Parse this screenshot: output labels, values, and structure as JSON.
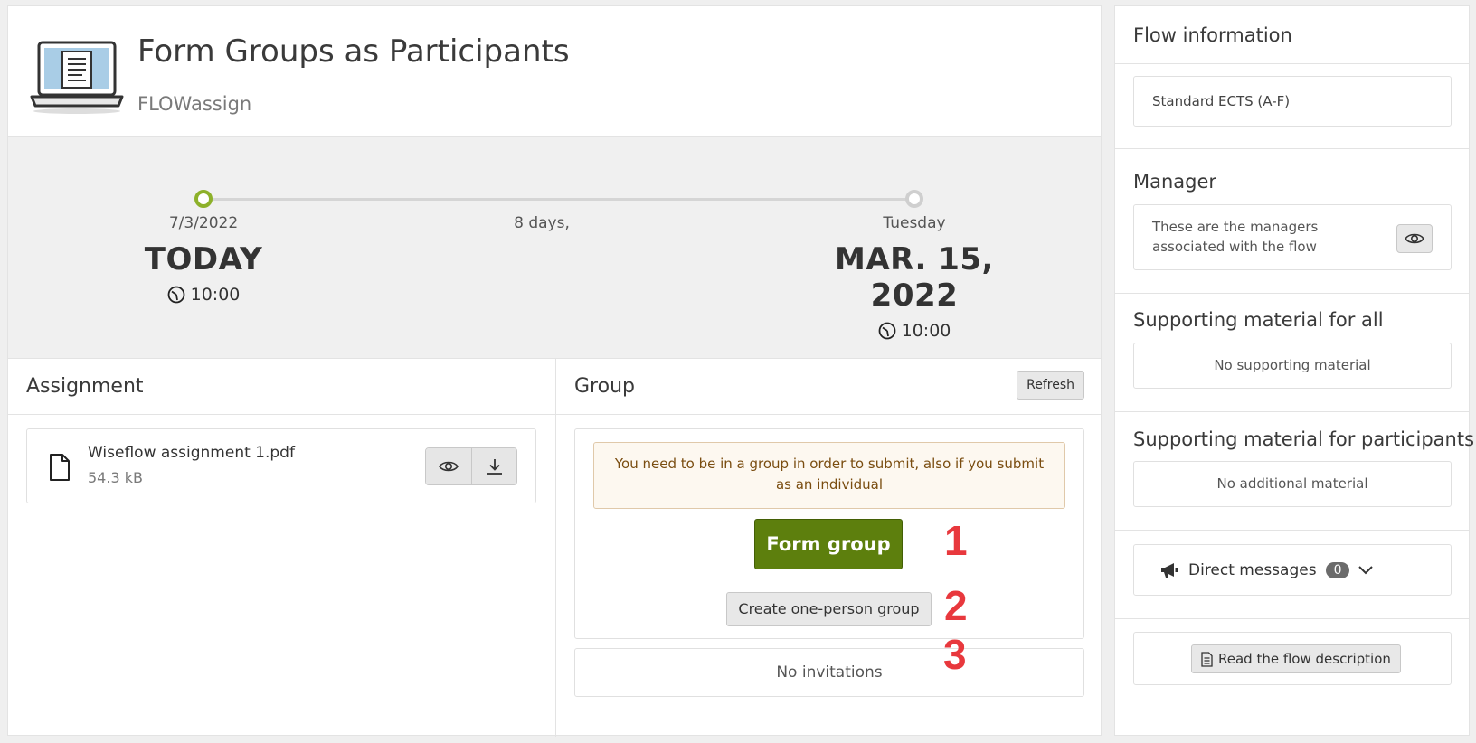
{
  "header": {
    "title": "Form Groups as Participants",
    "subtitle": "FLOWassign"
  },
  "timeline": {
    "start": {
      "date": "7/3/2022",
      "label": "TODAY",
      "time": "10:00"
    },
    "middle": {
      "label": "8 days,"
    },
    "end": {
      "weekday": "Tuesday",
      "label": "MAR. 15, 2022",
      "time": "10:00"
    },
    "colors": {
      "start_dot": "#8db12a",
      "end_dot": "#cfcfcf"
    }
  },
  "assignment": {
    "title": "Assignment",
    "file": {
      "name": "Wiseflow assignment 1.pdf",
      "size": "54.3 kB"
    }
  },
  "group": {
    "title": "Group",
    "refresh_label": "Refresh",
    "alert": "You need to be in a group in order to submit, also if you submit as an individual",
    "form_group_label": "Form group",
    "one_person_label": "Create one-person group",
    "invitations": "No invitations",
    "annotations": [
      "1",
      "2",
      "3"
    ]
  },
  "sidebar": {
    "flow_info": {
      "title": "Flow information",
      "grading": "Standard ECTS (A-F)"
    },
    "manager": {
      "title": "Manager",
      "text": "These are the managers associated with the flow"
    },
    "support_all": {
      "title": "Supporting material for all",
      "text": "No supporting material"
    },
    "support_participants": {
      "title": "Supporting material for participants",
      "text": "No additional material"
    },
    "direct_messages": {
      "label": "Direct messages",
      "count": "0"
    },
    "description_button": "Read the flow description"
  },
  "colors": {
    "primary": "#5d7f0d",
    "annotation": "#e8383d",
    "alert_bg": "#fdf8f0",
    "alert_text": "#7a4d10"
  }
}
